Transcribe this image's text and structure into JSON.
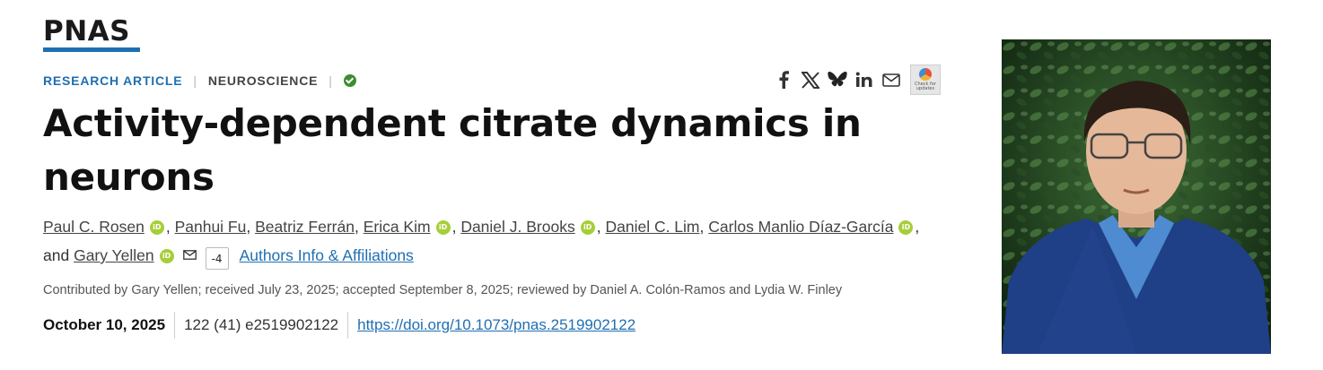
{
  "journal": {
    "logo_text": "PNAS",
    "accent_color": "#1f6fb2"
  },
  "article": {
    "type": "RESEARCH ARTICLE",
    "section": "NEUROSCIENCE",
    "title": "Activity-dependent citrate dynamics in neurons",
    "authors": [
      {
        "name": "Paul C. Rosen",
        "orcid": true
      },
      {
        "name": "Panhui Fu",
        "orcid": false
      },
      {
        "name": "Beatriz Ferrán",
        "orcid": false
      },
      {
        "name": "Erica Kim",
        "orcid": true
      },
      {
        "name": "Daniel J. Brooks",
        "orcid": true
      },
      {
        "name": "Daniel C. Lim",
        "orcid": false
      },
      {
        "name": "Carlos Manlio Díaz-García",
        "orcid": true
      },
      {
        "name": "Gary Yellen",
        "orcid": true
      }
    ],
    "author_connector": "and",
    "more_authors_badge": "-4",
    "affiliations_link": "Authors Info & Affiliations",
    "contributed": "Contributed by Gary Yellen; received July 23, 2025; accepted September 8, 2025; reviewed by Daniel A. Colón-Ramos and Lydia W. Finley",
    "pub_date": "October 10, 2025",
    "citation": "122 (41) e2519902122",
    "doi": "https://doi.org/10.1073/pnas.2519902122"
  },
  "share": {
    "icons": [
      "facebook-icon",
      "x-icon",
      "bluesky-icon",
      "linkedin-icon",
      "email-icon"
    ],
    "check_for_updates": "Check for updates"
  },
  "orcid_label": "iD"
}
